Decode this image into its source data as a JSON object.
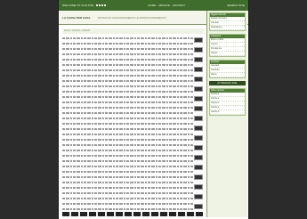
{
  "topbar": {
    "left_text": "WELCOME TO OUR SITE",
    "center_text": "HOME · ARCHIVE · CONTACT",
    "right_text": "SEARCH SITE"
  },
  "header": {
    "brand": "LA CASSA PER CASA",
    "tagline": "RIVISTA DI AGGIORNAMENTO E APPROFONDIMENTO",
    "cta": "ISCRIVITI"
  },
  "article": {
    "breadcrumb": "Home › Archivio › Articolo",
    "line_count": 34,
    "thumb_count": 18
  },
  "sidebar": {
    "boxes": [
      {
        "title": "Aggiornamenti",
        "items": [
          "Novità normative",
          "Circolari",
          "Modulistica"
        ]
      },
      {
        "title": "Categorie",
        "items": [
          "Fisco e tributi",
          "Lavoro",
          "Previdenza",
          "Sanità"
        ]
      },
      {
        "title": "Archivio",
        "items": [
          "Gennaio",
          "Febbraio",
          "Marzo"
        ]
      }
    ],
    "date": "27 MAGGIO 2011",
    "bottom_box": {
      "title": "Ultimi articoli",
      "items": [
        "Notizia 1",
        "Notizia 2",
        "Notizia 3",
        "Notizia 4",
        "Notizia 5"
      ]
    }
  }
}
